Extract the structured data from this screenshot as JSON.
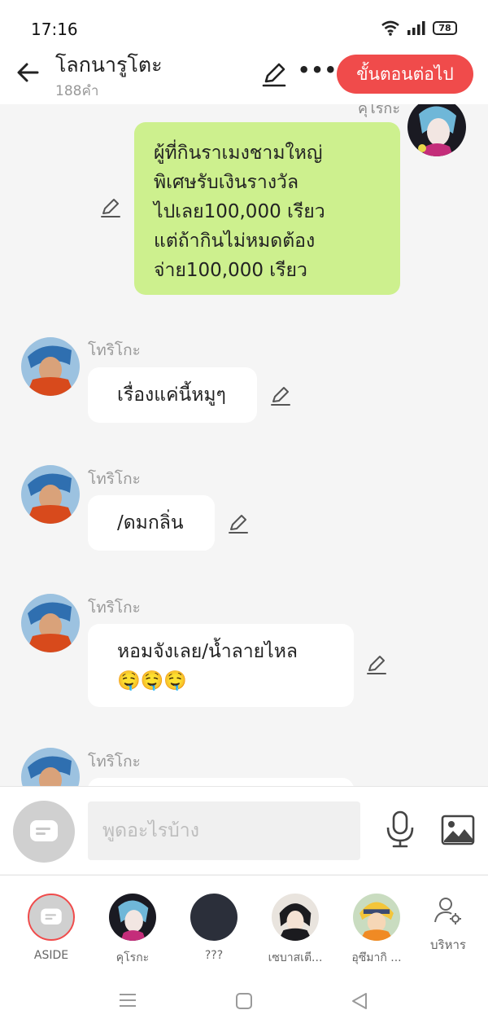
{
  "status": {
    "time": "17:16",
    "battery": "78"
  },
  "header": {
    "title": "โลกนารูโตะ",
    "subtitle": "188คำ",
    "next_label": "ขั้นตอนต่อไป"
  },
  "chat": {
    "partial_sender": "คุโรกะ",
    "messages": [
      {
        "sender": "คุโรกะ",
        "lines": [
          "ผู้ที่กินราเมงชามใหญ่",
          "พิเศษรับเงินรางวัล",
          "ไปเลย100,000 เรียว",
          "แต่ถ้ากินไม่หมดต้อง",
          "จ่าย100,000 เรียว"
        ]
      },
      {
        "sender": "โทริโกะ",
        "text": "เรื่องแค่นี้หมูๆ"
      },
      {
        "sender": "โทริโกะ",
        "text": "/ดมกลิ่น"
      },
      {
        "sender": "โทริโกะ",
        "lines": [
          "หอมจังเลย/น้ำลายไหล",
          "🤤🤤🤤"
        ]
      },
      {
        "sender": "โทริโกะ",
        "text": ""
      }
    ]
  },
  "input": {
    "placeholder": "พูดอะไรบ้าง"
  },
  "characters": [
    {
      "label": "ASIDE"
    },
    {
      "label": "คุโรกะ"
    },
    {
      "label": "???"
    },
    {
      "label": "เซบาสเตี..."
    },
    {
      "label": "อุซึมากิ ..."
    }
  ],
  "manage_label": "บริหาร",
  "colors": {
    "accent": "#f04b4b",
    "user_bubble": "#cdf08e",
    "background": "#f5f5f5"
  },
  "icons": {
    "back": "arrow-left-icon",
    "edit": "pencil-icon",
    "more": "more-dots-icon",
    "mic": "microphone-icon",
    "image": "image-icon",
    "manage": "user-settings-icon"
  }
}
